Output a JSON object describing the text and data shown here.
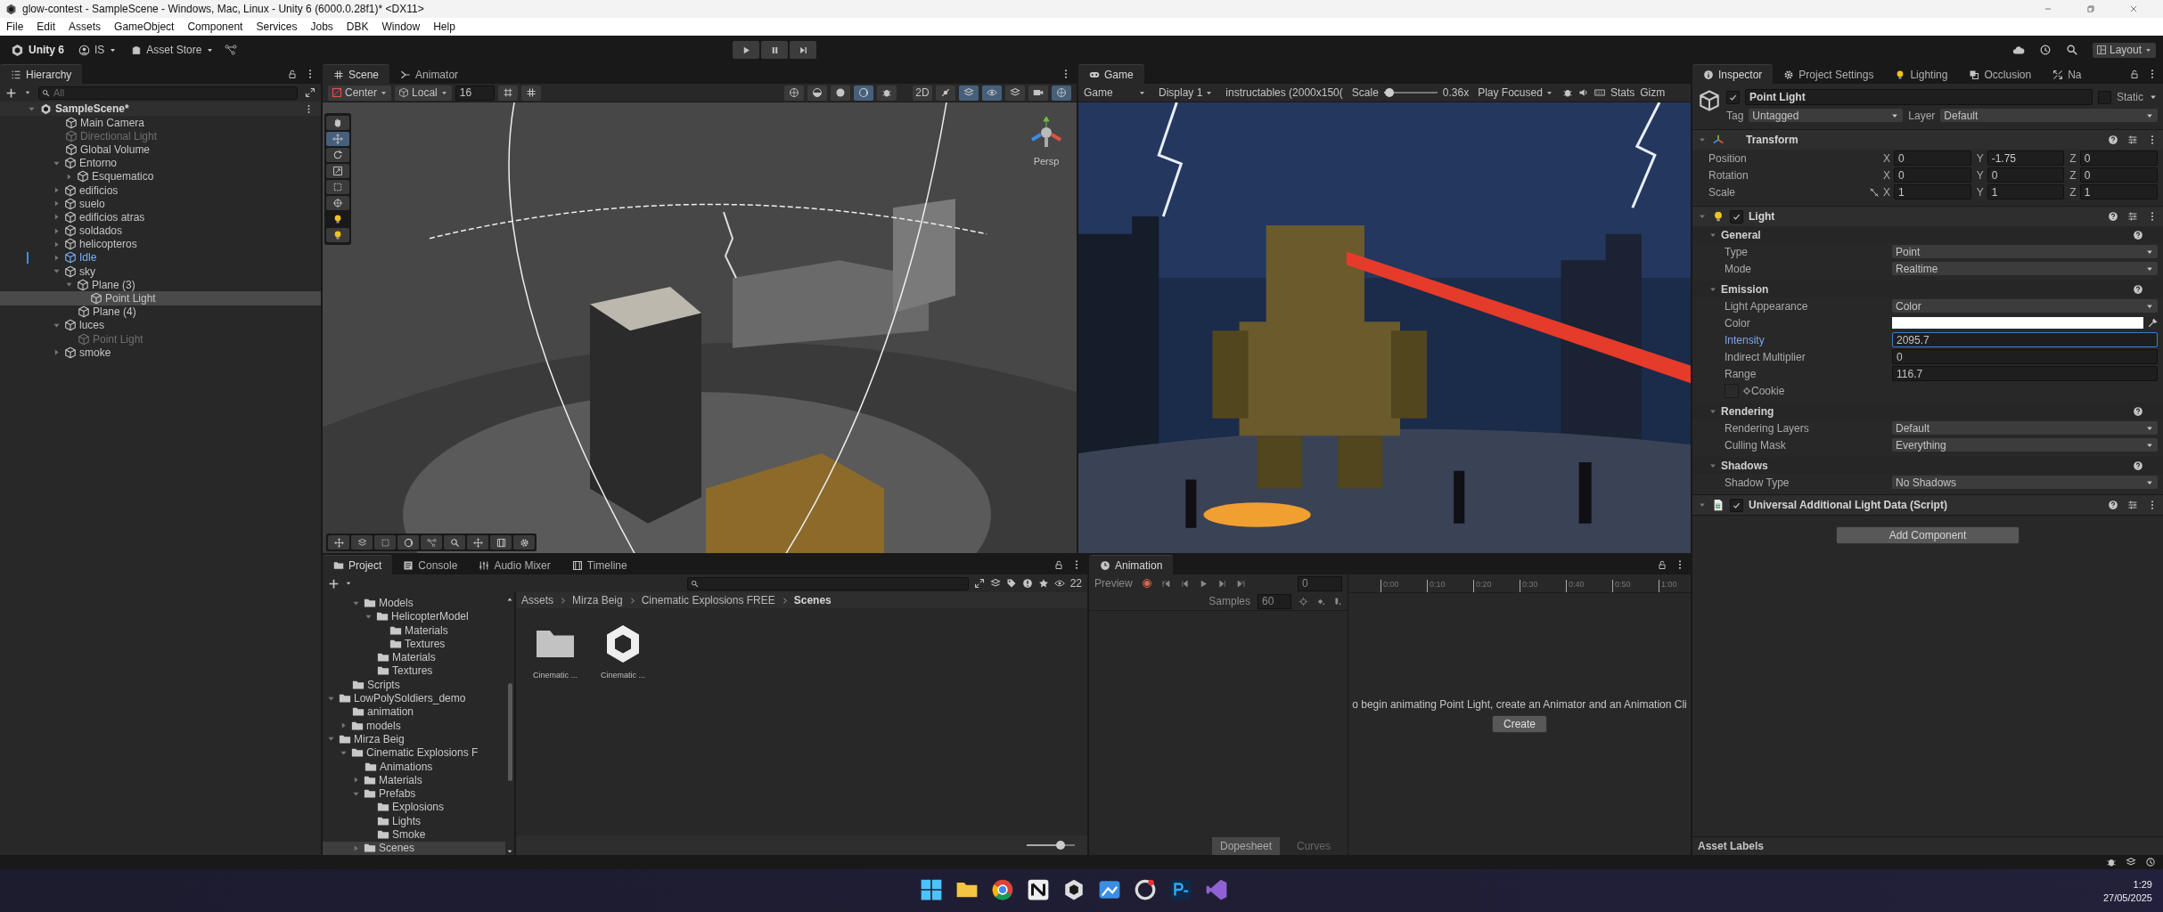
{
  "window": {
    "title": "glow-contest - SampleScene - Windows, Mac, Linux - Unity 6 (6000.0.28f1)* <DX11>"
  },
  "menu": [
    "File",
    "Edit",
    "Assets",
    "GameObject",
    "Component",
    "Services",
    "Jobs",
    "DBK",
    "Window",
    "Help"
  ],
  "toolbar": {
    "logo": "Unity 6",
    "account": "IS",
    "store": "Asset Store",
    "layout": "Layout"
  },
  "hierarchy": {
    "title": "Hierarchy",
    "search": {
      "placeholder": "All"
    },
    "scene": {
      "name": "SampleScene*",
      "expanded": true,
      "children": [
        {
          "name": "Main Camera",
          "kind": "object",
          "disabled": false,
          "selected": false
        },
        {
          "name": "Directional Light",
          "kind": "object",
          "disabled": true,
          "selected": false
        },
        {
          "name": "Global Volume",
          "kind": "object",
          "disabled": false,
          "selected": false
        },
        {
          "name": "Entorno",
          "kind": "object",
          "disabled": false,
          "selected": false,
          "expanded": true,
          "children": [
            {
              "name": "Esquematico",
              "kind": "object",
              "disabled": false,
              "selected": false,
              "expanded": false
            }
          ]
        },
        {
          "name": "edificios",
          "kind": "object",
          "disabled": false,
          "selected": false,
          "expanded": false
        },
        {
          "name": "suelo",
          "kind": "object",
          "disabled": false,
          "selected": false,
          "expanded": false
        },
        {
          "name": "edificios atras",
          "kind": "object",
          "disabled": false,
          "selected": false,
          "expanded": false
        },
        {
          "name": "soldados",
          "kind": "object",
          "disabled": false,
          "selected": false,
          "expanded": false
        },
        {
          "name": "helicopteros",
          "kind": "object",
          "disabled": false,
          "selected": false,
          "expanded": false
        },
        {
          "name": "Idle",
          "kind": "prefab",
          "disabled": false,
          "selected": false,
          "expanded": false
        },
        {
          "name": "sky",
          "kind": "object",
          "disabled": false,
          "selected": false,
          "expanded": true,
          "children": [
            {
              "name": "Plane (3)",
              "kind": "object",
              "disabled": false,
              "selected": false,
              "expanded": true,
              "children": [
                {
                  "name": "Point Light",
                  "kind": "object",
                  "disabled": false,
                  "selected": true
                }
              ]
            },
            {
              "name": "Plane (4)",
              "kind": "object",
              "disabled": false,
              "selected": false
            }
          ]
        },
        {
          "name": "luces",
          "kind": "object",
          "disabled": false,
          "selected": false,
          "expanded": true,
          "children": [
            {
              "name": "Point Light",
              "kind": "object",
              "disabled": true,
              "selected": false
            }
          ]
        },
        {
          "name": "smoke",
          "kind": "object",
          "disabled": false,
          "selected": false,
          "expanded": false
        }
      ]
    }
  },
  "scene_view": {
    "tabs": [
      {
        "label": "Scene",
        "selected": true
      },
      {
        "label": "Animator",
        "selected": false
      }
    ],
    "pivot": "Center",
    "space": "Local",
    "grid_size": "16",
    "mode_2d": "2D",
    "projection": "Persp"
  },
  "game_view": {
    "tab": "Game",
    "mode": "Game",
    "display": "Display 1",
    "resolution": "instructables (2000x150(",
    "scale_label": "Scale",
    "scale": {
      "level": 0.1
    },
    "scale_value": "0.36x",
    "play_mode": "Play Focused",
    "stats": "Stats",
    "gizmos": "Gizm"
  },
  "inspector": {
    "tabs": [
      {
        "label": "Inspector",
        "selected": true
      },
      {
        "label": "Project Settings",
        "selected": false
      },
      {
        "label": "Lighting",
        "selected": false
      },
      {
        "label": "Occlusion",
        "selected": false
      },
      {
        "label": "Na",
        "selected": false
      }
    ],
    "object": {
      "name": "Point Light",
      "active": true,
      "static_label": "Static",
      "static": false,
      "tag_label": "Tag",
      "tag": "Untagged",
      "layer_label": "Layer",
      "layer": "Default"
    },
    "transform": {
      "title": "Transform",
      "rows": [
        {
          "label": "Position",
          "values": [
            {
              "axis": "X",
              "value": "0"
            },
            {
              "axis": "Y",
              "value": "-1.75"
            },
            {
              "axis": "Z",
              "value": "0"
            }
          ]
        },
        {
          "label": "Rotation",
          "values": [
            {
              "axis": "X",
              "value": "0"
            },
            {
              "axis": "Y",
              "value": "0"
            },
            {
              "axis": "Z",
              "value": "0"
            }
          ]
        },
        {
          "label": "Scale",
          "proportional": false,
          "values": [
            {
              "axis": "X",
              "value": "1"
            },
            {
              "axis": "Y",
              "value": "1"
            },
            {
              "axis": "Z",
              "value": "1"
            }
          ]
        }
      ]
    },
    "components": [
      {
        "title": "Light",
        "kind": "light",
        "enabled": true,
        "sections": [
          {
            "title": "General",
            "rows": [
              {
                "kind": "dropdown",
                "label": "Type",
                "value": "Point"
              },
              {
                "kind": "dropdown",
                "label": "Mode",
                "value": "Realtime"
              }
            ]
          },
          {
            "title": "Emission",
            "rows": [
              {
                "kind": "dropdown",
                "label": "Light Appearance",
                "value": "Color"
              },
              {
                "kind": "color",
                "label": "Color",
                "color": "#ffffff"
              },
              {
                "kind": "field",
                "label": "Intensity",
                "value": "2095.7",
                "focused": true
              },
              {
                "kind": "field",
                "label": "Indirect Multiplier",
                "value": "0",
                "focused": false
              },
              {
                "kind": "field",
                "label": "Range",
                "value": "116.7",
                "focused": false
              },
              {
                "kind": "object",
                "label": "Cookie"
              }
            ]
          },
          {
            "title": "Rendering",
            "rows": [
              {
                "kind": "dropdown",
                "label": "Rendering Layers",
                "value": "Default"
              },
              {
                "kind": "dropdown",
                "label": "Culling Mask",
                "value": "Everything"
              }
            ]
          },
          {
            "title": "Shadows",
            "rows": [
              {
                "kind": "dropdown",
                "label": "Shadow Type",
                "value": "No Shadows"
              }
            ]
          }
        ]
      },
      {
        "title": "Universal Additional Light Data (Script)",
        "kind": "script",
        "enabled": true
      }
    ],
    "add_component": "Add Component",
    "asset_labels": "Asset Labels"
  },
  "project": {
    "tabs": [
      {
        "label": "Project",
        "selected": true
      },
      {
        "label": "Console",
        "selected": false
      },
      {
        "label": "Audio Mixer",
        "selected": false
      },
      {
        "label": "Timeline",
        "selected": false
      }
    ],
    "count": "22",
    "tree": [
      {
        "children": [
          {
            "children": [
              {
                "name": "Models",
                "expanded": true,
                "selected": false,
                "children": [
                  {
                    "name": "HelicopterModel",
                    "expanded": true,
                    "selected": false,
                    "children": [
                      {
                        "name": "Materials",
                        "selected": false
                      },
                      {
                        "name": "Textures",
                        "selected": false
                      }
                    ]
                  },
                  {
                    "name": "Materials",
                    "selected": false
                  },
                  {
                    "name": "Textures",
                    "selected": false
                  }
                ]
              }
            ]
          },
          {
            "name": "Scripts",
            "selected": false
          }
        ]
      },
      {
        "name": "LowPolySoldiers_demo",
        "expanded": true,
        "selected": false,
        "children": [
          {
            "name": "animation",
            "selected": false
          },
          {
            "name": "models",
            "expanded": false,
            "selected": false
          }
        ]
      },
      {
        "name": "Mirza Beig",
        "expanded": true,
        "selected": false,
        "children": [
          {
            "name": "Cinematic Explosions F",
            "expanded": true,
            "selected": false,
            "children": [
              {
                "name": "Animations",
                "selected": false
              },
              {
                "name": "Materials",
                "expanded": false,
                "selected": false
              },
              {
                "name": "Prefabs",
                "expanded": true,
                "selected": false,
                "children": [
                  {
                    "name": "Explosions",
                    "selected": false
                  },
                  {
                    "name": "Lights",
                    "selected": false
                  },
                  {
                    "name": "Smoke",
                    "selected": false
                  }
                ]
              },
              {
                "name": "Scenes",
                "expanded": false,
                "selected": true
              }
            ]
          }
        ]
      }
    ],
    "breadcrumb": [
      "Assets",
      "Mirza Beig",
      "Cinematic Explosions FREE",
      "Scenes"
    ],
    "assets": [
      {
        "name": "Cinematic ...",
        "kind": "folder"
      },
      {
        "name": "Cinematic ...",
        "kind": "scene"
      }
    ],
    "zoom": {
      "level": 0.7
    }
  },
  "animation": {
    "tab": "Animation",
    "preview": "Preview",
    "frame": "0",
    "samples_label": "Samples",
    "samples": "60",
    "ruler": [
      "0:00",
      "0:10",
      "0:20",
      "0:30",
      "0:40",
      "0:50",
      "1:00"
    ],
    "message": "o begin animating Point Light, create an Animator and an Animation Cli",
    "create": "Create",
    "views": [
      {
        "label": "Dopesheet",
        "selected": true
      },
      {
        "label": "Curves",
        "selected": false
      }
    ]
  },
  "taskbar": {
    "time": "1:29",
    "date": "27/05/2025"
  }
}
